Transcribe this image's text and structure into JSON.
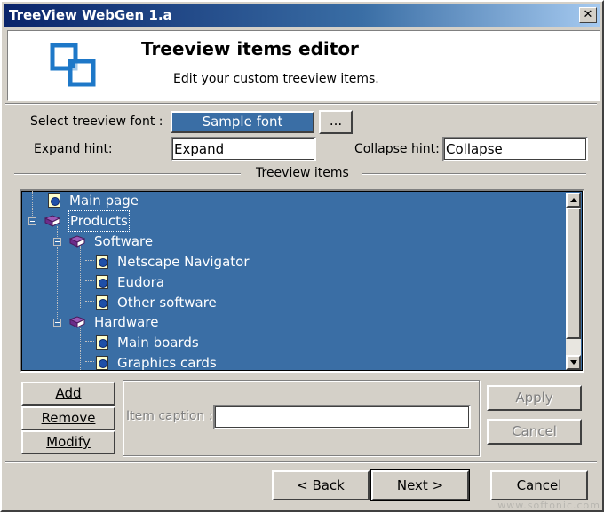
{
  "window": {
    "title": "TreeView WebGen 1.a",
    "close_glyph": "✕"
  },
  "header": {
    "title": "Treeview items editor",
    "subtitle": "Edit your custom treeview items."
  },
  "font": {
    "label": "Select treeview font :",
    "sample": "Sample font",
    "browse": "..."
  },
  "hints": {
    "expand_label": "Expand hint:",
    "expand_value": "Expand",
    "collapse_label": "Collapse hint:",
    "collapse_value": "Collapse"
  },
  "tree": {
    "section_label": "Treeview items",
    "items": [
      {
        "label": "Main page",
        "icon": "doc-icon",
        "level": 0
      },
      {
        "label": "Products",
        "icon": "book-icon",
        "level": 0,
        "selected": true,
        "expanded": true
      },
      {
        "label": "Software",
        "icon": "book-icon",
        "level": 1,
        "expanded": true
      },
      {
        "label": "Netscape Navigator",
        "icon": "doc-icon",
        "level": 2
      },
      {
        "label": "Eudora",
        "icon": "doc-icon",
        "level": 2
      },
      {
        "label": "Other software",
        "icon": "doc-icon",
        "level": 2
      },
      {
        "label": "Hardware",
        "icon": "book-icon",
        "level": 1,
        "expanded": true
      },
      {
        "label": "Main boards",
        "icon": "doc-icon",
        "level": 2
      },
      {
        "label": "Graphics cards",
        "icon": "doc-icon",
        "level": 2
      }
    ]
  },
  "actions": {
    "add": "Add",
    "remove": "Remove",
    "modify": "Modify"
  },
  "edit": {
    "caption_label": "Item caption :",
    "caption_value": "",
    "apply": "Apply",
    "cancel": "Cancel"
  },
  "footer": {
    "back": "< Back",
    "next": "Next >",
    "cancel": "Cancel"
  },
  "watermark": "www.softonic.com",
  "colors": {
    "tree_bg": "#3a6ea5",
    "titlebar": "#0a246a",
    "face": "#d4d0c8"
  }
}
